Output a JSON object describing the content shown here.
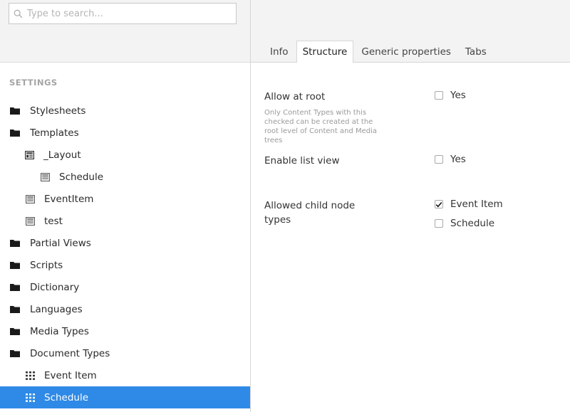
{
  "search": {
    "placeholder": "Type to search..."
  },
  "sidebar": {
    "section_title": "SETTINGS",
    "items": [
      {
        "label": "Stylesheets",
        "icon": "folder-icon"
      },
      {
        "label": "Templates",
        "icon": "folder-icon"
      },
      {
        "label": "_Layout",
        "icon": "template-icon"
      },
      {
        "label": "Schedule",
        "icon": "template-icon"
      },
      {
        "label": "EventItem",
        "icon": "template-icon"
      },
      {
        "label": "test",
        "icon": "template-icon"
      },
      {
        "label": "Partial Views",
        "icon": "folder-icon"
      },
      {
        "label": "Scripts",
        "icon": "folder-icon"
      },
      {
        "label": "Dictionary",
        "icon": "folder-icon"
      },
      {
        "label": "Languages",
        "icon": "folder-icon"
      },
      {
        "label": "Media Types",
        "icon": "folder-icon"
      },
      {
        "label": "Document Types",
        "icon": "folder-icon"
      },
      {
        "label": "Event Item",
        "icon": "grid-icon"
      },
      {
        "label": "Schedule",
        "icon": "grid-icon",
        "selected": true
      }
    ]
  },
  "tabs": [
    {
      "label": "Info"
    },
    {
      "label": "Structure",
      "active": true
    },
    {
      "label": "Generic properties"
    },
    {
      "label": "Tabs"
    }
  ],
  "structure": {
    "allow_at_root": {
      "label": "Allow at root",
      "description": "Only Content Types with this checked can be created at the root level of Content and Media trees",
      "option": "Yes",
      "checked": false
    },
    "enable_list_view": {
      "label": "Enable list view",
      "option": "Yes",
      "checked": false
    },
    "allowed_child_node_types": {
      "label_line1": "Allowed child node",
      "label_line2": "types",
      "options": [
        {
          "label": "Event Item",
          "checked": true
        },
        {
          "label": "Schedule",
          "checked": false
        }
      ]
    }
  },
  "colors": {
    "selected": "#2e8ae6",
    "header_bg": "#f3f3f3",
    "section_title": "#a4a4a4"
  }
}
